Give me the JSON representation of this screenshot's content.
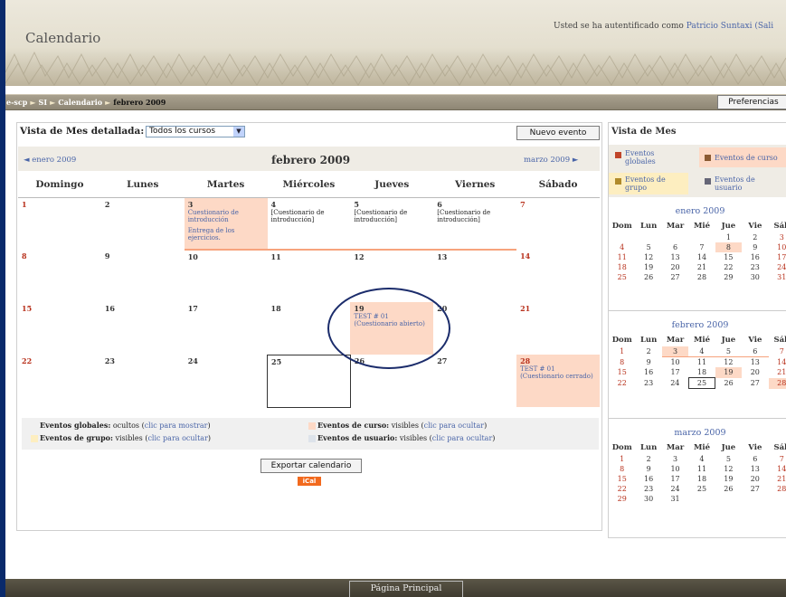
{
  "header": {
    "site_title": "Calendario",
    "login_prefix": "Usted se ha autentificado como",
    "user_name": "Patricio Suntaxi",
    "logout_partial": "(Sali"
  },
  "breadcrumb": {
    "items": [
      "e-scp",
      "SI",
      "Calendario"
    ],
    "current": "febrero 2009"
  },
  "preferences_button": "Preferencias",
  "main": {
    "heading": "Vista de Mes detallada:",
    "course_select": "Todos los cursos",
    "new_event_button": "Nuevo evento",
    "prev_month": "◄ enero 2009",
    "next_month": "marzo 2009 ►",
    "month_title": "febrero 2009",
    "weekdays": [
      "Domingo",
      "Lunes",
      "Martes",
      "Miércoles",
      "Jueves",
      "Viernes",
      "Sábado"
    ],
    "events": {
      "cuestionario_intro": "Cuestionario de introducción",
      "entrega": "Entrega de los ejercicios.",
      "cuestionario_cont": "[Cuestionario de introducción]",
      "test_open": "TEST # 01 (Cuestionario abierto)",
      "test_closed": "TEST # 01 (Cuestionario cerrado)"
    },
    "days": [
      "1",
      "2",
      "3",
      "4",
      "5",
      "6",
      "7",
      "8",
      "9",
      "10",
      "11",
      "12",
      "13",
      "14",
      "15",
      "16",
      "17",
      "18",
      "19",
      "20",
      "21",
      "22",
      "23",
      "24",
      "25",
      "26",
      "27",
      "28"
    ]
  },
  "legend": {
    "global_label": "Eventos globales:",
    "global_state": "ocultos",
    "global_link": "clic para mostrar",
    "course_label": "Eventos de curso:",
    "course_state": "visibles",
    "course_link": "clic para ocultar",
    "group_label": "Eventos de grupo:",
    "group_state": "visibles",
    "group_link": "clic para ocultar",
    "user_label": "Eventos de usuario:",
    "user_state": "visibles",
    "user_link": "clic para ocultar",
    "open_paren": "(",
    "close_paren": ")"
  },
  "export_button": "Exportar calendario",
  "ical_badge": "iCal",
  "sidebar": {
    "title": "Vista de Mes",
    "legend": {
      "global": "Eventos globales",
      "course": "Eventos de curso",
      "group": "Eventos de grupo",
      "user": "Eventos de usuario"
    },
    "weekday_abbr": [
      "Dom",
      "Lun",
      "Mar",
      "Mié",
      "Jue",
      "Vie",
      "Sáb"
    ],
    "jan_title": "enero 2009",
    "feb_title": "febrero 2009",
    "mar_title": "marzo 2009"
  },
  "footer": {
    "home_button": "Página Principal"
  },
  "colors": {
    "course_event": "#fdd9c6",
    "group_event": "#fdeec0",
    "user_event": "#dde3ea",
    "weekend_red": "#b8321d",
    "link_blue": "#4a65a8"
  }
}
